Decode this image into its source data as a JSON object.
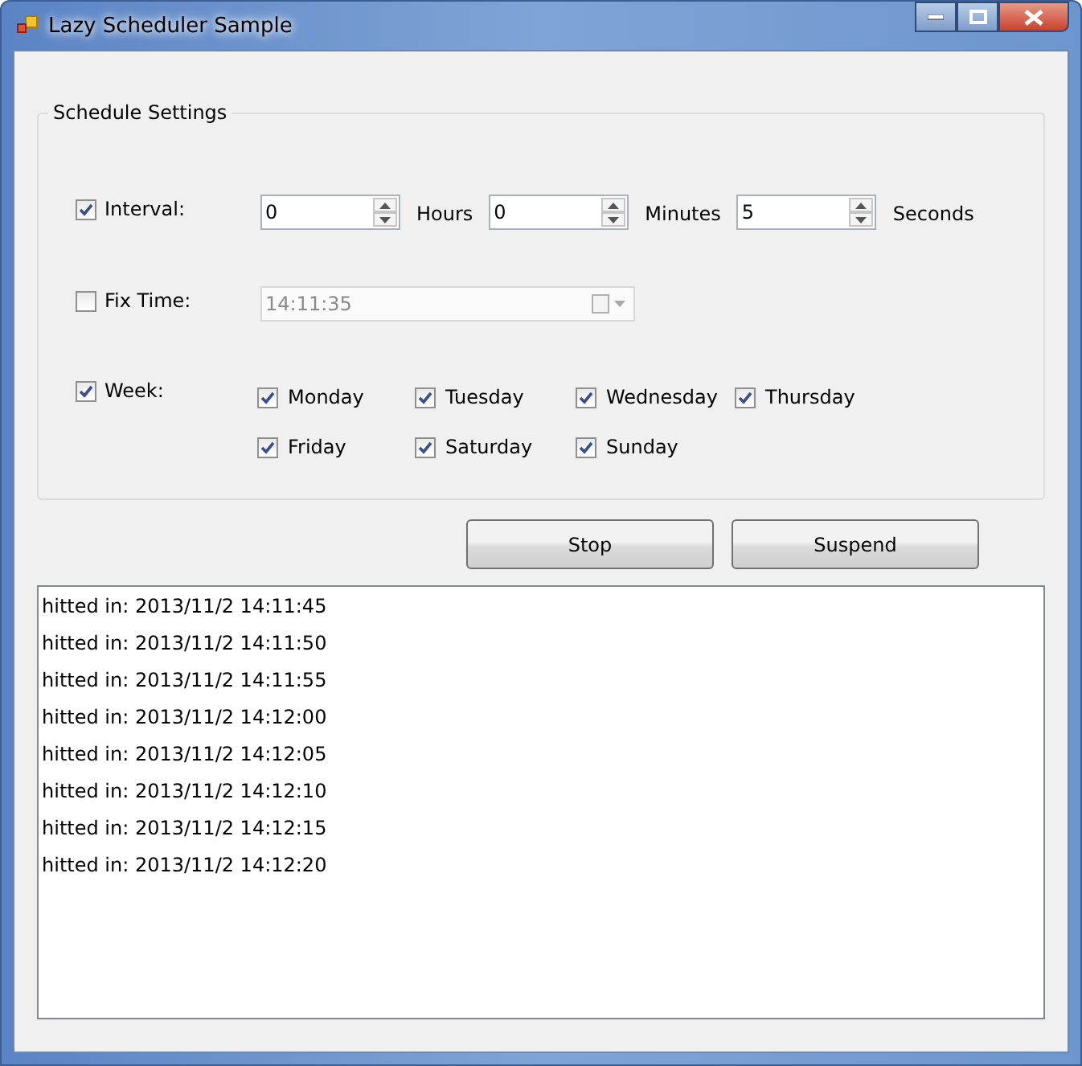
{
  "window": {
    "title": "Lazy Scheduler Sample"
  },
  "schedule_settings": {
    "title": "Schedule Settings",
    "interval": {
      "label": "Interval:",
      "checked": true,
      "fields": [
        {
          "value": "0",
          "unit": "Hours"
        },
        {
          "value": "0",
          "unit": "Minutes"
        },
        {
          "value": "5",
          "unit": "Seconds"
        }
      ]
    },
    "fix_time": {
      "label": "Fix Time:",
      "checked": false,
      "value": "14:11:35",
      "disabled": true
    },
    "week": {
      "label": "Week:",
      "checked": true,
      "days": [
        {
          "label": "Monday",
          "checked": true
        },
        {
          "label": "Tuesday",
          "checked": true
        },
        {
          "label": "Wednesday",
          "checked": true
        },
        {
          "label": "Thursday",
          "checked": true
        },
        {
          "label": "Friday",
          "checked": true
        },
        {
          "label": "Saturday",
          "checked": true
        },
        {
          "label": "Sunday",
          "checked": true
        }
      ]
    }
  },
  "buttons": [
    "Stop",
    "Suspend"
  ],
  "log": {
    "lines": [
      "hitted in: 2013/11/2 14:11:45",
      "hitted in: 2013/11/2 14:11:50",
      "hitted in: 2013/11/2 14:11:55",
      "hitted in: 2013/11/2 14:12:00",
      "hitted in: 2013/11/2 14:12:05",
      "hitted in: 2013/11/2 14:12:10",
      "hitted in: 2013/11/2 14:12:15",
      "hitted in: 2013/11/2 14:12:20"
    ]
  }
}
